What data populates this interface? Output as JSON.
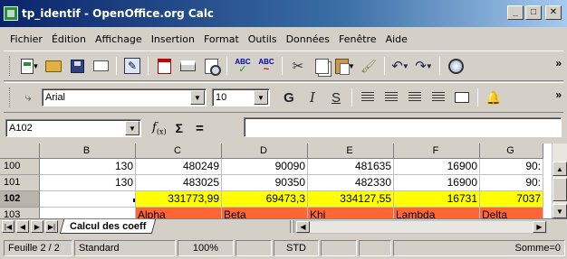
{
  "window": {
    "title": "tp_identif - OpenOffice.org Calc",
    "minimize": "_",
    "maximize": "□",
    "close": "✕"
  },
  "menu": [
    "Fichier",
    "Édition",
    "Affichage",
    "Insertion",
    "Format",
    "Outils",
    "Données",
    "Fenêtre",
    "Aide"
  ],
  "format_toolbar": {
    "font": "Arial",
    "size": "10",
    "bold": "G",
    "italic": "I",
    "underline": "S"
  },
  "formula_bar": {
    "cell_ref": "A102",
    "fx": "f(x)",
    "sum": "Σ",
    "equals": "=",
    "content": ""
  },
  "grid": {
    "columns": [
      "B",
      "C",
      "D",
      "E",
      "F",
      "G"
    ],
    "rows": [
      {
        "header": "100",
        "cells": [
          "130",
          "480249",
          "90090",
          "481635",
          "16900",
          "90:"
        ]
      },
      {
        "header": "101",
        "cells": [
          "130",
          "483025",
          "90350",
          "482330",
          "16900",
          "90:"
        ]
      },
      {
        "header": "102",
        "cells": [
          "",
          "331773,99",
          "69473,3",
          "334127,55",
          "16731",
          "7037"
        ]
      },
      {
        "header": "103",
        "cells": [
          "",
          "Alpha",
          "Beta",
          "Khi",
          "Lambda",
          "Delta"
        ]
      }
    ],
    "highlight_yellow": "#ffff00",
    "highlight_orange": "#ff6633"
  },
  "sheet_tab": "Calcul des coeff",
  "status": {
    "sheet": "Feuille 2 / 2",
    "style": "Standard",
    "zoom": "100%",
    "mode": "STD",
    "sum": "Somme=0"
  }
}
